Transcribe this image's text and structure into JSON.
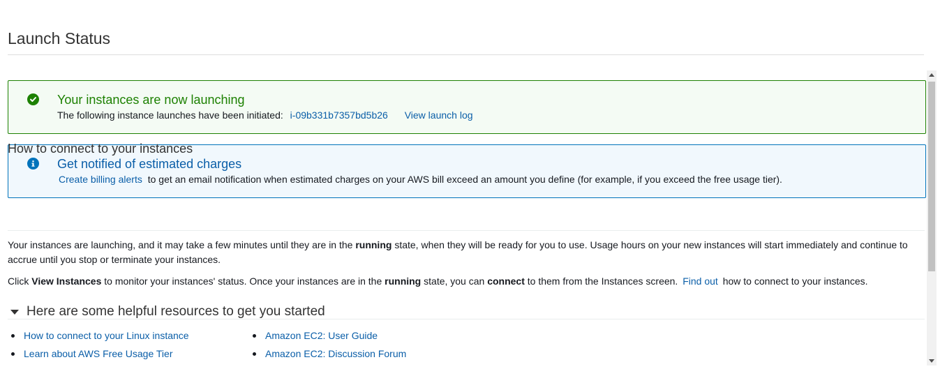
{
  "page": {
    "title": "Launch Status"
  },
  "success_alert": {
    "title": "Your instances are now launching",
    "body_prefix": "The following instance launches have been initiated:",
    "instance_id": "i-09b331b7357bd5b26",
    "view_log_label": "View launch log",
    "icon": "check-circle-icon",
    "color": "#1d8102"
  },
  "info_alert": {
    "title": "Get notified of estimated charges",
    "billing_link": "Create billing alerts",
    "body_suffix": "to get an email notification when estimated charges on your AWS bill exceed an amount you define (for example, if you exceed the free usage tier).",
    "icon": "info-circle-icon",
    "color": "#0073bb"
  },
  "connect_section": {
    "heading": "How to connect to your instances",
    "para1": {
      "part1": "Your instances are launching, and it may take a few minutes until they are in the ",
      "bold1": "running",
      "part2": " state, when they will be ready for you to use. Usage hours on your new instances will start immediately and continue to accrue until you stop or terminate your instances."
    },
    "para2": {
      "part1": "Click ",
      "bold1": "View Instances",
      "part2": " to monitor your instances' status. Once your instances are in the ",
      "bold2": "running",
      "part3": " state, you can ",
      "bold3": "connect",
      "part4": " to them from the Instances screen.",
      "link": "Find out",
      "part5": "how to connect to your instances."
    }
  },
  "resources": {
    "heading": "Here are some helpful resources to get you started",
    "column1": [
      "How to connect to your Linux instance",
      "Learn about AWS Free Usage Tier"
    ],
    "column2": [
      "Amazon EC2: User Guide",
      "Amazon EC2: Discussion Forum"
    ]
  }
}
